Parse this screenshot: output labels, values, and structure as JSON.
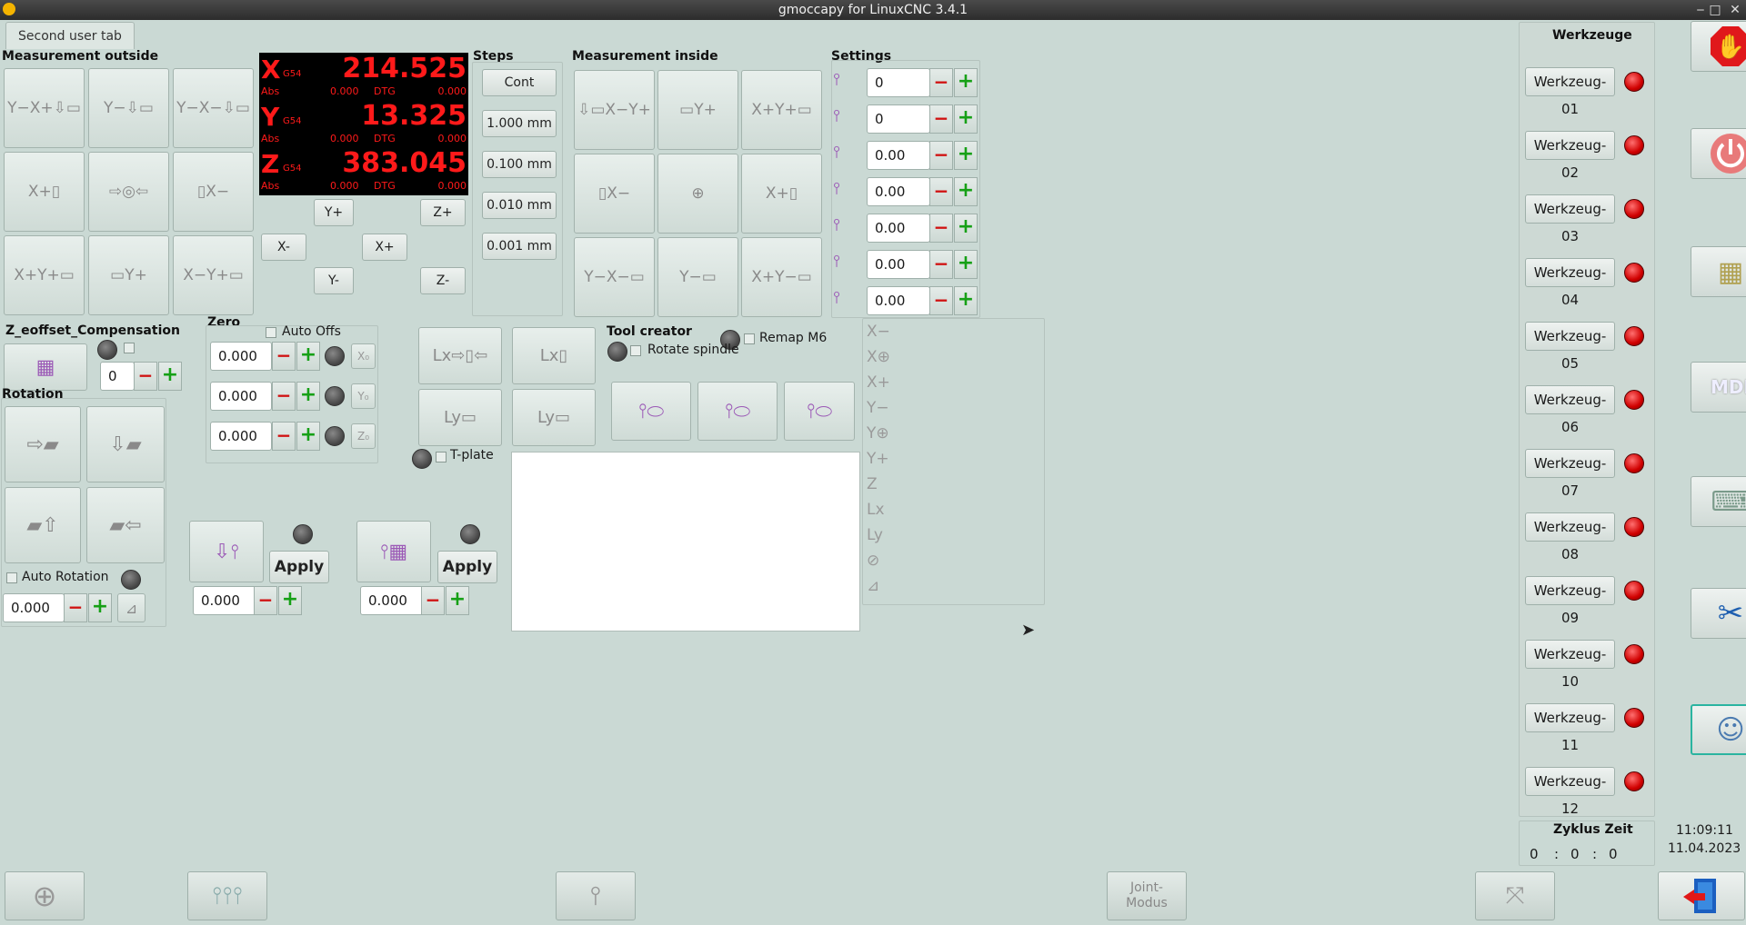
{
  "window": {
    "title": "gmoccapy for LinuxCNC 3.4.1",
    "min": "‒",
    "max": "□",
    "close": "✕"
  },
  "tab": {
    "label": "Second user tab"
  },
  "sections": {
    "measurement_outside": "Measurement outside",
    "steps": "Steps",
    "measurement_inside": "Measurement inside",
    "settings": "Settings",
    "z_eoffset": "Z_eoffset_Compensation",
    "zero": "Zero",
    "rotation": "Rotation",
    "tool_creator": "Tool creator"
  },
  "dro": {
    "x": {
      "axis": "X",
      "coord": "G54",
      "value": "214.525",
      "abs_label": "Abs",
      "abs": "0.000",
      "dtg_label": "DTG",
      "dtg": "0.000"
    },
    "y": {
      "axis": "Y",
      "coord": "G54",
      "value": "13.325",
      "abs_label": "Abs",
      "abs": "0.000",
      "dtg_label": "DTG",
      "dtg": "0.000"
    },
    "z": {
      "axis": "Z",
      "coord": "G54",
      "value": "383.045",
      "abs_label": "Abs",
      "abs": "0.000",
      "dtg_label": "DTG",
      "dtg": "0.000"
    }
  },
  "jog": {
    "yplus": "Y+",
    "yminus": "Y-",
    "xplus": "X+",
    "xminus": "X-",
    "zplus": "Z+",
    "zminus": "Z-"
  },
  "steps": [
    "Cont",
    "1.000 mm",
    "0.100 mm",
    "0.010 mm",
    "0.001 mm"
  ],
  "settings_values": [
    "0",
    "0",
    "0.00",
    "0.00",
    "0.00",
    "0.00",
    "0.00"
  ],
  "eoffset": {
    "value": "0"
  },
  "zero": {
    "auto_offs": "Auto Offs",
    "values": [
      "0.000",
      "0.000",
      "0.000"
    ],
    "axis_icons": [
      "X₀",
      "Y₀",
      "Z₀"
    ]
  },
  "rotation": {
    "auto_rotation": "Auto Rotation",
    "value": "0.000"
  },
  "probe_apply": {
    "apply1": "Apply",
    "apply2": "Apply",
    "value1": "0.000",
    "value2": "0.000"
  },
  "tplate": "T-plate",
  "tool_creator": {
    "remap": "Remap M6",
    "rotate": "Rotate spindle"
  },
  "side_icons": [
    "X−",
    "X⊕",
    "X+",
    "Y−",
    "Y⊕",
    "Y+",
    "Z",
    "Lx",
    "Ly",
    "⊘",
    "⊿"
  ],
  "werkzeuge": {
    "title": "Werkzeuge",
    "tools": [
      "Werkzeug-01",
      "Werkzeug-02",
      "Werkzeug-03",
      "Werkzeug-04",
      "Werkzeug-05",
      "Werkzeug-06",
      "Werkzeug-07",
      "Werkzeug-08",
      "Werkzeug-09",
      "Werkzeug-10",
      "Werkzeug-11",
      "Werkzeug-12"
    ]
  },
  "zyklus": {
    "label": "Zyklus Zeit",
    "h": "0",
    "m": "0",
    "s": "0",
    "sep": ":"
  },
  "clock": {
    "time": "11:09:11",
    "date": "11.04.2023"
  },
  "bottom": {
    "joint": "Joint-\nModus"
  },
  "colors": {
    "background": "#cad9d4",
    "dro_text": "#ff1a1a",
    "led_red": "#d00000"
  }
}
